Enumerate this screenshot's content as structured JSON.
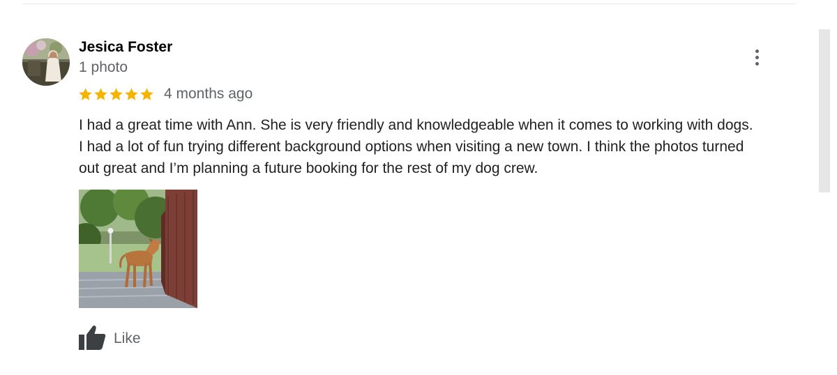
{
  "review": {
    "reviewer_name": "Jesica Foster",
    "reviewer_meta": "1 photo",
    "rating": 5,
    "rating_max": 5,
    "date": "4 months ago",
    "text_lines": [
      "I had a great time with Ann. She is very friendly and knowledgeable when it comes to working with dogs.",
      "I had a lot of fun trying different background options when visiting a new town. I think the photos turned",
      "out great and I’m planning a future booking for the rest of my dog crew."
    ],
    "like_label": "Like"
  },
  "icons": {
    "star": "star-icon",
    "more": "more-vert-icon",
    "like": "thumbs-up-icon"
  },
  "colors": {
    "star": "#f4b400",
    "name": "#000000",
    "secondary_text": "#5f6368",
    "body_text": "#202124",
    "like_icon": "#3c4043"
  }
}
